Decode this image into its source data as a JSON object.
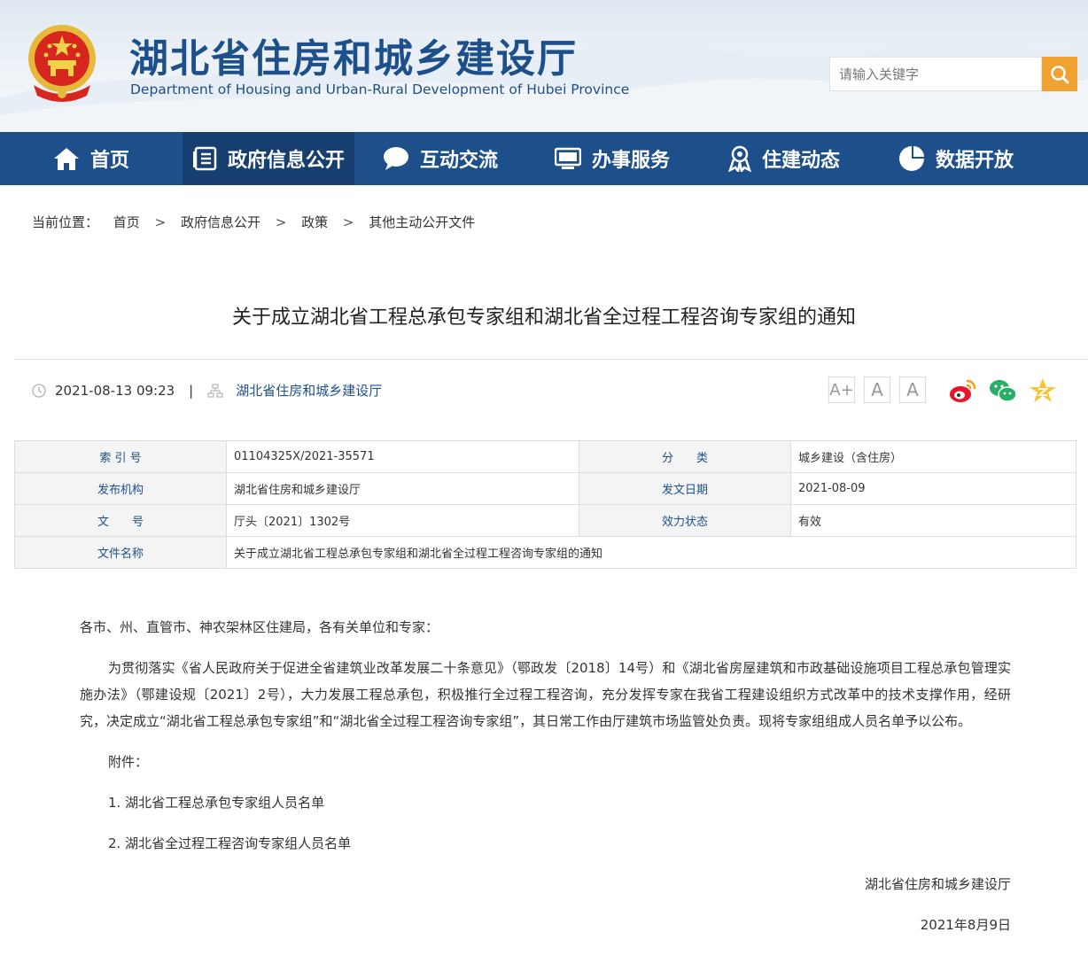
{
  "header": {
    "title": "湖北省住房和城乡建设厅",
    "subtitle": "Department of Housing and Urban-Rural Development of Hubei Province",
    "search_placeholder": "请输入关键字",
    "search_icon": "search-icon"
  },
  "nav": {
    "items": [
      {
        "label": "首页",
        "icon": "home-icon"
      },
      {
        "label": "政府信息公开",
        "icon": "document-list-icon",
        "active": true
      },
      {
        "label": "互动交流",
        "icon": "chat-bubble-icon"
      },
      {
        "label": "办事服务",
        "icon": "monitor-icon"
      },
      {
        "label": "住建动态",
        "icon": "award-icon"
      },
      {
        "label": "数据开放",
        "icon": "pie-chart-icon"
      }
    ]
  },
  "breadcrumb": {
    "prefix": "当前位置：",
    "items": [
      "首页",
      "政府信息公开",
      "政策",
      "其他主动公开文件"
    ],
    "separator": ">"
  },
  "article": {
    "title": "关于成立湖北省工程总承包专家组和湖北省全过程工程咨询专家组的通知",
    "datetime": "2021-08-13 09:23",
    "meta_separator": "|",
    "source": "湖北省住房和城乡建设厅",
    "font_buttons": [
      "A+",
      "A",
      "A"
    ],
    "share": [
      "weibo-icon",
      "wechat-icon",
      "qzone-icon"
    ]
  },
  "info_table": {
    "row1": {
      "label1": "索 引 号",
      "value1": "01104325X/2021-35571",
      "label2": "分　　类",
      "value2": "城乡建设（含住房）"
    },
    "row2": {
      "label1": "发布机构",
      "value1": "湖北省住房和城乡建设厅",
      "label2": "发文日期",
      "value2": "2021-08-09"
    },
    "row3": {
      "label1": "文　　号",
      "value1": "厅头〔2021〕1302号",
      "label2": "效力状态",
      "value2": "有效"
    },
    "row4": {
      "label1": "文件名称",
      "value1": "关于成立湖北省工程总承包专家组和湖北省全过程工程咨询专家组的通知"
    }
  },
  "body": {
    "salutation": "各市、州、直管市、神农架林区住建局，各有关单位和专家：",
    "paragraph": "为贯彻落实《省人民政府关于促进全省建筑业改革发展二十条意见》（鄂政发〔2018〕14号）和《湖北省房屋建筑和市政基础设施项目工程总承包管理实施办法》（鄂建设规〔2021〕2号），大力发展工程总承包，积极推行全过程工程咨询，充分发挥专家在我省工程建设组织方式改革中的技术支撑作用，经研究，决定成立“湖北省工程总承包专家组”和“湖北省全过程工程咨询专家组”，其日常工作由厅建筑市场监管处负责。现将专家组组成人员名单予以公布。",
    "attachment_label": "附件：",
    "attachments": [
      "1. 湖北省工程总承包专家组人员名单",
      "2. 湖北省全过程工程咨询专家组人员名单"
    ],
    "signature": "湖北省住房和城乡建设厅",
    "date": "2021年8月9日"
  },
  "colors": {
    "primary": "#1d4f8b",
    "nav_active": "#163f70",
    "search_button": "#f0a230"
  }
}
